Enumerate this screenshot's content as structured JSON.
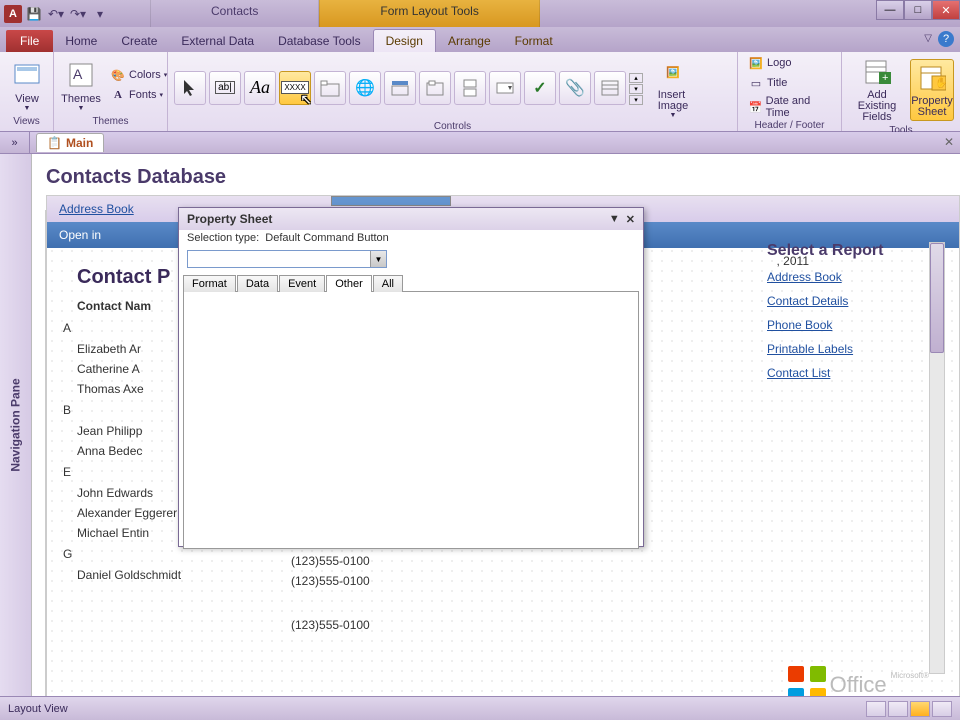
{
  "app": {
    "title_context1": "Contacts",
    "title_context2": "Form Layout Tools"
  },
  "tabs": {
    "file": "File",
    "home": "Home",
    "create": "Create",
    "external": "External Data",
    "dbtools": "Database Tools",
    "design": "Design",
    "arrange": "Arrange",
    "format": "Format"
  },
  "ribbon": {
    "view": "View",
    "views_label": "Views",
    "themes": "Themes",
    "colors": "Colors",
    "fonts": "Fonts",
    "themes_label": "Themes",
    "controls_label": "Controls",
    "insert_image": "Insert\nImage",
    "logo": "Logo",
    "title": "Title",
    "datetime": "Date and Time",
    "hf_label": "Header / Footer",
    "add_fields": "Add Existing\nFields",
    "property_sheet": "Property\nSheet",
    "tools_label": "Tools"
  },
  "doctab": "Main",
  "navpane": "Navigation Pane",
  "form": {
    "title": "Contacts Database",
    "link1": "Address Book",
    "banner_open": "Open in",
    "sec_head": "Contact P",
    "date_text": ", 2011",
    "col_name": "Contact Nam",
    "groups": [
      {
        "letter": "A",
        "rows": [
          "Elizabeth Ar",
          "Catherine A",
          "Thomas Axe"
        ]
      },
      {
        "letter": "B",
        "rows": [
          "Jean Philipp",
          "Anna Bedec"
        ]
      },
      {
        "letter": "E",
        "rows": [
          "John Edwards",
          "Alexander Eggerer",
          "Michael Entin"
        ]
      },
      {
        "letter": "G",
        "rows": [
          "Daniel Goldschmidt"
        ]
      }
    ],
    "phones": [
      "(123)555-0100",
      "(123)555-0100",
      "(123)555-0100",
      "(123)555-0100"
    ]
  },
  "reports": {
    "heading": "Select a Report",
    "items": [
      "Address Book",
      "Contact Details",
      "Phone Book",
      "Printable Labels",
      "Contact List"
    ]
  },
  "office_brand": "Office",
  "propsheet": {
    "title": "Property Sheet",
    "sel_label": "Selection type:",
    "sel_value": "Default Command Button",
    "tabs": {
      "format": "Format",
      "data": "Data",
      "event": "Event",
      "other": "Other",
      "all": "All"
    }
  },
  "status": {
    "view": "Layout View"
  }
}
